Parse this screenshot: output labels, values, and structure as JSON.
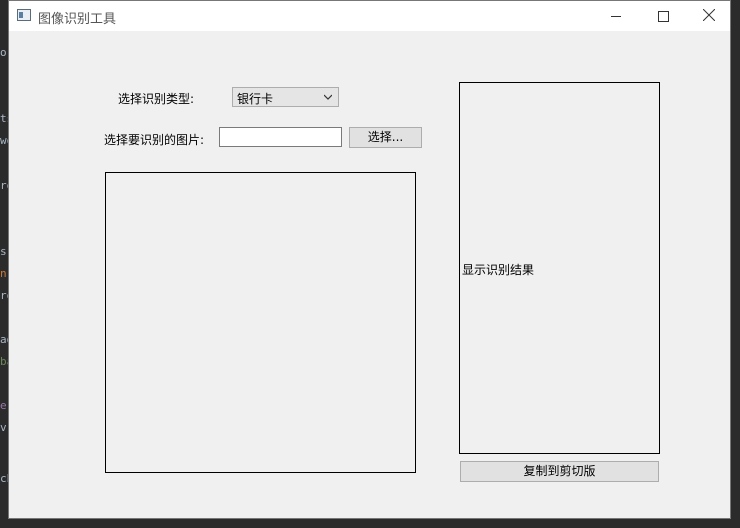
{
  "window": {
    "title": "图像识别工具",
    "controls": {
      "minimize": "—",
      "maximize": "☐",
      "close": "✕"
    }
  },
  "form": {
    "type_label": "选择识别类型:",
    "type_select": {
      "value": "银行卡"
    },
    "image_label": "选择要识别的图片:",
    "image_path": {
      "value": "",
      "placeholder": ""
    },
    "select_button": "选择..."
  },
  "result": {
    "placeholder": "显示识别结果",
    "copy_button": "复制到剪切版"
  },
  "background_editor": {
    "fragments": [
      "or",
      "ts",
      "wo",
      "ro",
      "s",
      "n",
      "ro",
      "ad",
      "ba",
      "e",
      "v",
      "ch"
    ]
  }
}
